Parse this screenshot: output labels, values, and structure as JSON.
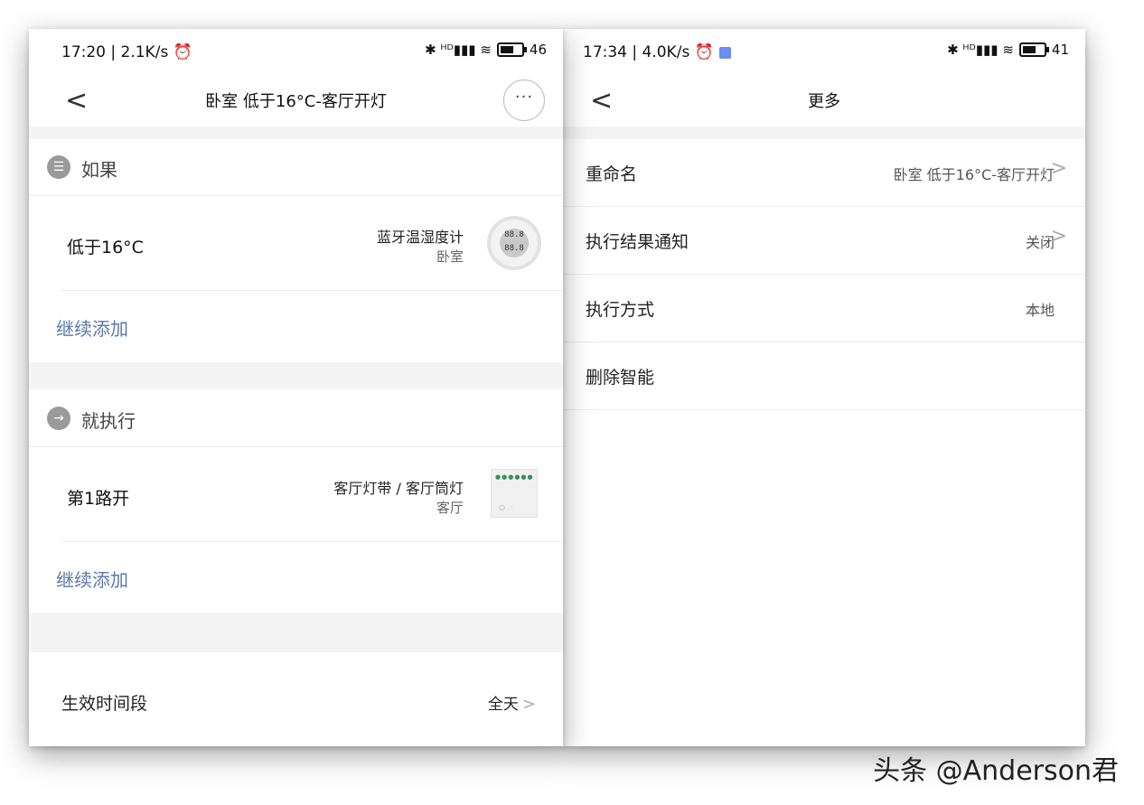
{
  "left_screen": {
    "status": {
      "time": "17:20 | 2.1K/s ⏰",
      "icons": "✱ ᴴᴰ▮▮▮ ≋",
      "battery": "46"
    },
    "nav": {
      "back": "<",
      "title": "卧室 低于16°C-客厅开灯",
      "more": "···"
    },
    "if_section": {
      "icon": "☰",
      "label": "如果",
      "condition": "低于16°C",
      "device": "蓝牙温湿度计",
      "room": "卧室",
      "sensor_display": "88.8 88.8",
      "add": "继续添加"
    },
    "then_section": {
      "icon": "→",
      "label": "就执行",
      "action": "第1路开",
      "device": "客厅灯带 / 客厅筒灯",
      "room": "客厅",
      "add": "继续添加"
    },
    "footer": {
      "label": "生效时间段",
      "value": "全天",
      "chevron": ">"
    }
  },
  "right_screen": {
    "status": {
      "time": "17:34 | 4.0K/s ⏰",
      "icons": "✱ ᴴᴰ▮▮▮ ≋",
      "battery": "41"
    },
    "nav": {
      "back": "<",
      "title": "更多"
    },
    "rows": [
      {
        "label": "重命名",
        "value": "卧室 低于16°C-客厅开灯",
        "chevron": ">"
      },
      {
        "label": "执行结果通知",
        "value": "关闭",
        "chevron": ">"
      },
      {
        "label": "执行方式",
        "value": "本地",
        "chevron": ""
      },
      {
        "label": "删除智能",
        "value": "",
        "chevron": ""
      }
    ]
  },
  "watermark": "头条 @Anderson君",
  "colors": {
    "link": "#5a78a8",
    "gap": "#f4f4f4",
    "icon_gray": "#9a9a9a"
  }
}
